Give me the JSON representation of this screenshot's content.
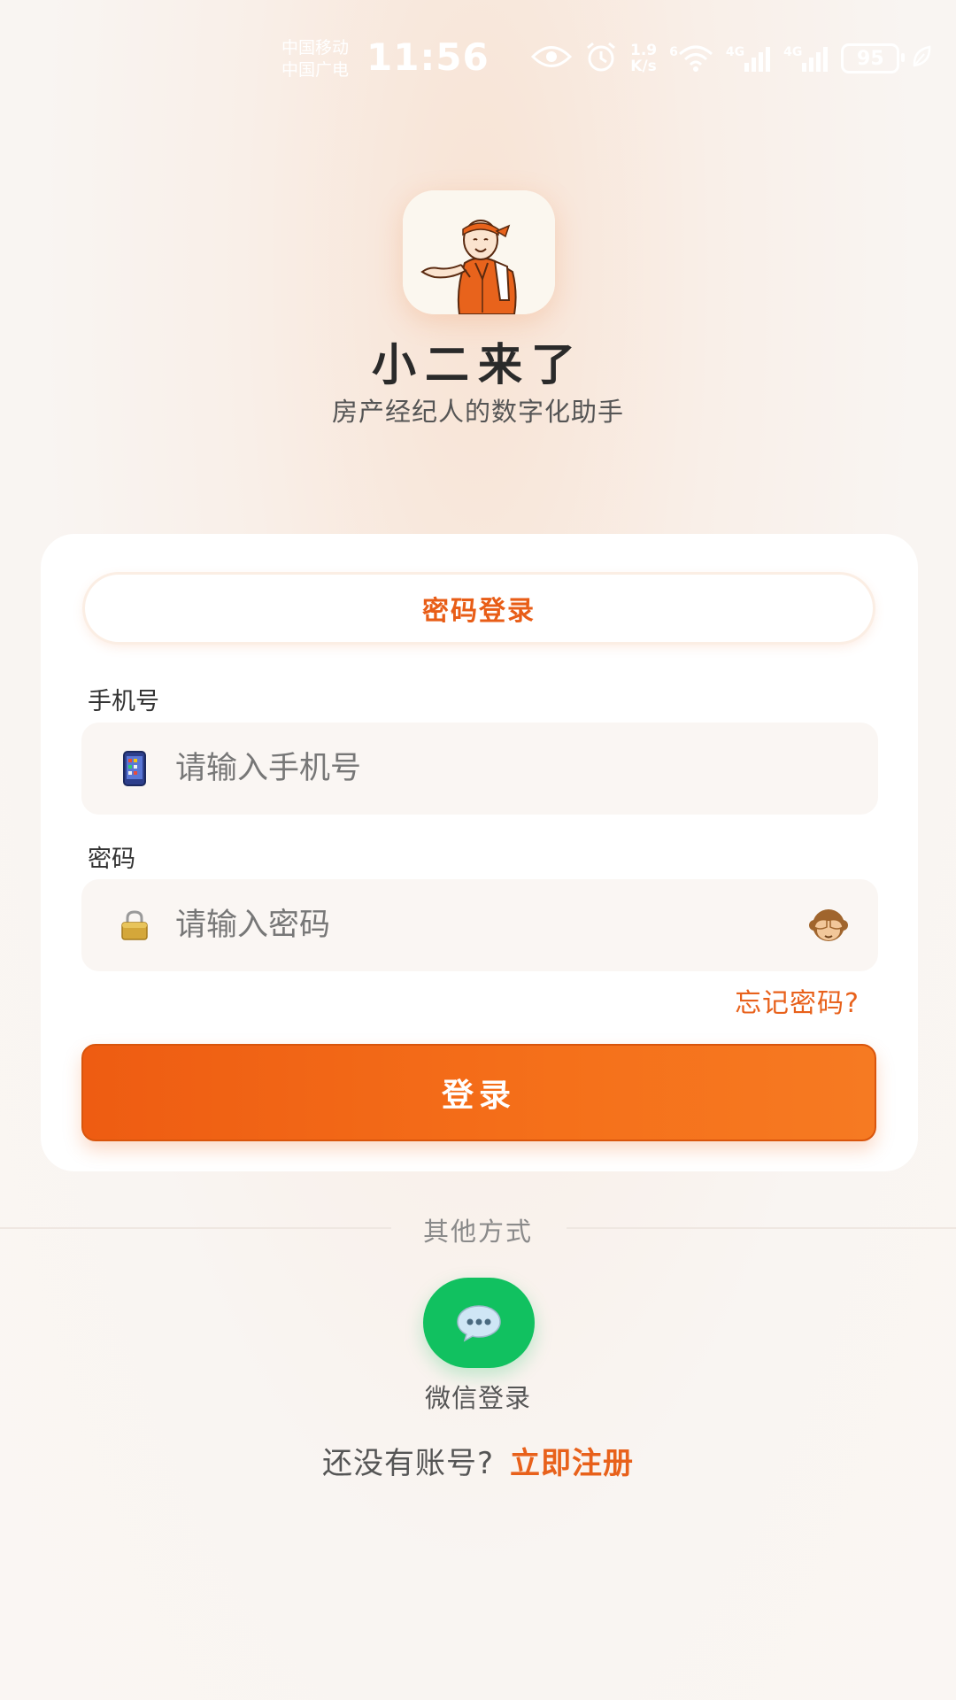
{
  "status_bar": {
    "carrier_1": "中国移动",
    "carrier_2": "中国广电",
    "time": "11:56",
    "net_speed_value": "1.9",
    "net_speed_unit": "K/s",
    "wifi_label": "6",
    "signal_1_label": "4G",
    "signal_2_label": "4G",
    "battery": "95"
  },
  "app": {
    "title": "小二来了",
    "subtitle": "房产经纪人的数字化助手"
  },
  "login_form": {
    "tab_label": "密码登录",
    "phone_label": "手机号",
    "phone_placeholder": "请输入手机号",
    "password_label": "密码",
    "password_placeholder": "请输入密码",
    "forgot_password": "忘记密码?",
    "login_button": "登录"
  },
  "other_methods": {
    "label": "其他方式",
    "wechat_label": "微信登录"
  },
  "register": {
    "prompt": "还没有账号?",
    "link": "立即注册"
  },
  "colors": {
    "accent": "#e8611b",
    "wechat": "#11c160"
  },
  "icons": {
    "phone_input": "mobile-phone-icon",
    "password_input": "lock-icon",
    "password_toggle": "see-no-evil-monkey-icon",
    "wechat": "chat-bubble-icon"
  }
}
